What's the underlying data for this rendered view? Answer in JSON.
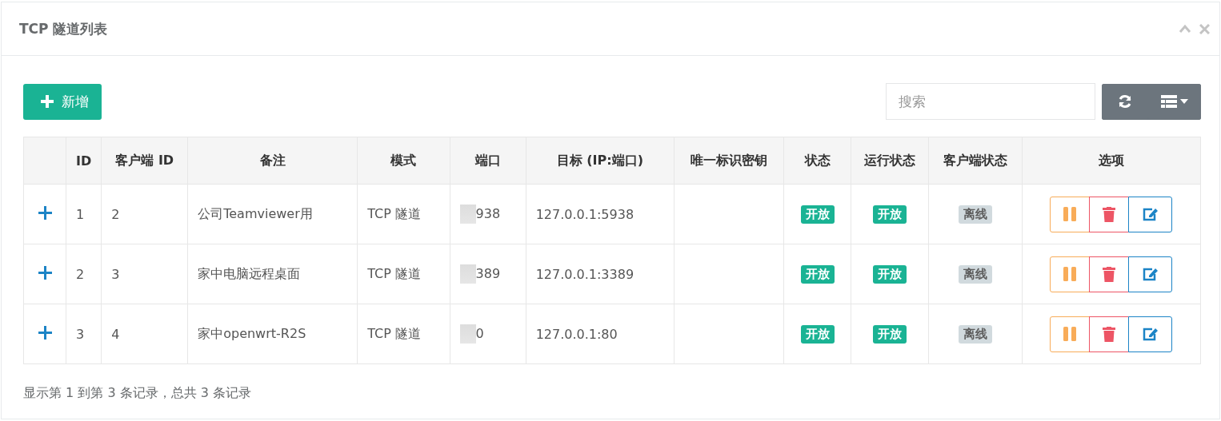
{
  "panel": {
    "title": "TCP 隧道列表"
  },
  "toolbar": {
    "add_label": "新增",
    "search": {
      "placeholder": "搜索"
    }
  },
  "table": {
    "columns": [
      "ID",
      "客户端 ID",
      "备注",
      "模式",
      "端口",
      "目标 (IP:端口)",
      "唯一标识密钥",
      "状态",
      "运行状态",
      "客户端状态",
      "选项"
    ],
    "rows": [
      {
        "id": "1",
        "client_id": "2",
        "note": "公司Teamviewer用",
        "mode": "TCP 隧道",
        "port": "938",
        "target": "127.0.0.1:5938",
        "key": "",
        "status": {
          "label": "开放",
          "kind": "success"
        },
        "run_status": {
          "label": "开放",
          "kind": "success"
        },
        "client_status": {
          "label": "离线",
          "kind": "muted"
        }
      },
      {
        "id": "2",
        "client_id": "3",
        "note": "家中电脑远程桌面",
        "mode": "TCP 隧道",
        "port": "389",
        "target": "127.0.0.1:3389",
        "key": "",
        "status": {
          "label": "开放",
          "kind": "success"
        },
        "run_status": {
          "label": "开放",
          "kind": "success"
        },
        "client_status": {
          "label": "离线",
          "kind": "muted"
        }
      },
      {
        "id": "3",
        "client_id": "4",
        "note": "家中openwrt-R2S",
        "mode": "TCP 隧道",
        "port": "0",
        "target": "127.0.0.1:80",
        "key": "",
        "status": {
          "label": "开放",
          "kind": "success"
        },
        "run_status": {
          "label": "开放",
          "kind": "success"
        },
        "client_status": {
          "label": "离线",
          "kind": "muted"
        }
      }
    ]
  },
  "footer": "显示第 1 到第 3 条记录，总共 3 条记录"
}
